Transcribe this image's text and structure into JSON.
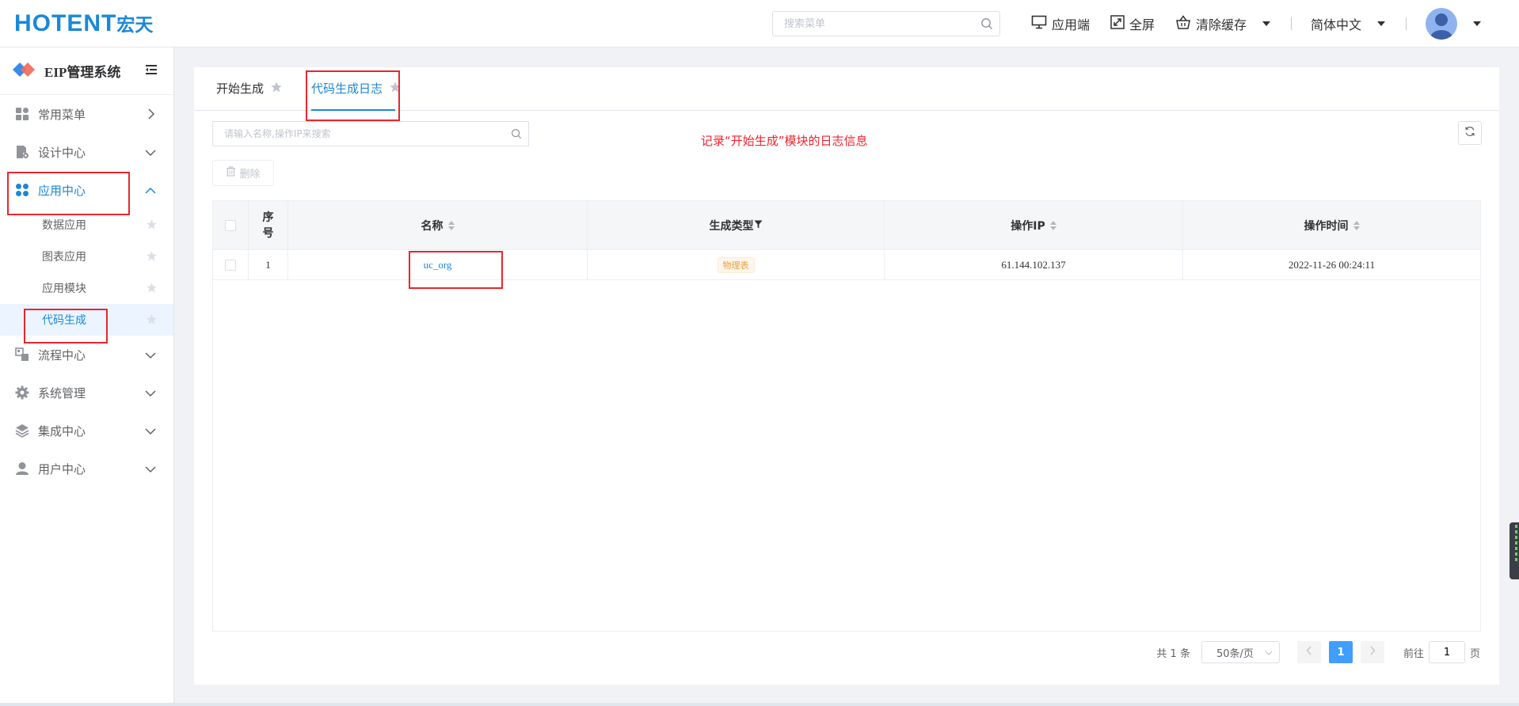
{
  "header": {
    "logo_text": "HOTENT",
    "logo_cn": "宏天",
    "search_placeholder": "搜索菜单",
    "actions": {
      "app_side": "应用端",
      "fullscreen": "全屏",
      "clear_cache": "清除缓存",
      "language": "简体中文"
    }
  },
  "sidebar": {
    "system_title": "EIP管理系统",
    "menu": [
      {
        "label": "常用菜单"
      },
      {
        "label": "设计中心"
      },
      {
        "label": "应用中心"
      },
      {
        "label": "流程中心"
      },
      {
        "label": "系统管理"
      },
      {
        "label": "集成中心"
      },
      {
        "label": "用户中心"
      }
    ],
    "submenu": [
      {
        "label": "数据应用"
      },
      {
        "label": "图表应用"
      },
      {
        "label": "应用模块"
      },
      {
        "label": "代码生成"
      }
    ]
  },
  "tabs": [
    {
      "label": "开始生成"
    },
    {
      "label": "代码生成日志"
    }
  ],
  "toolbar": {
    "search_placeholder": "请输入名称,操作IP来搜索",
    "delete_label": "删除",
    "annotation": "记录“开始生成”模块的日志信息"
  },
  "table": {
    "headers": {
      "index": "序号",
      "name": "名称",
      "type": "生成类型",
      "ip": "操作IP",
      "time": "操作时间"
    },
    "rows": [
      {
        "index": "1",
        "name": "uc_org",
        "type": "物理表",
        "ip": "61.144.102.137",
        "time": "2022-11-26 00:24:11"
      }
    ]
  },
  "pagination": {
    "total": "共 1 条",
    "page_size": "50条/页",
    "current_page": "1",
    "goto_prefix": "前往",
    "goto_value": "1",
    "goto_suffix": "页"
  },
  "colors": {
    "primary": "#1a88d8",
    "highlight": "#e8262d",
    "tag": "#e6a23c"
  }
}
